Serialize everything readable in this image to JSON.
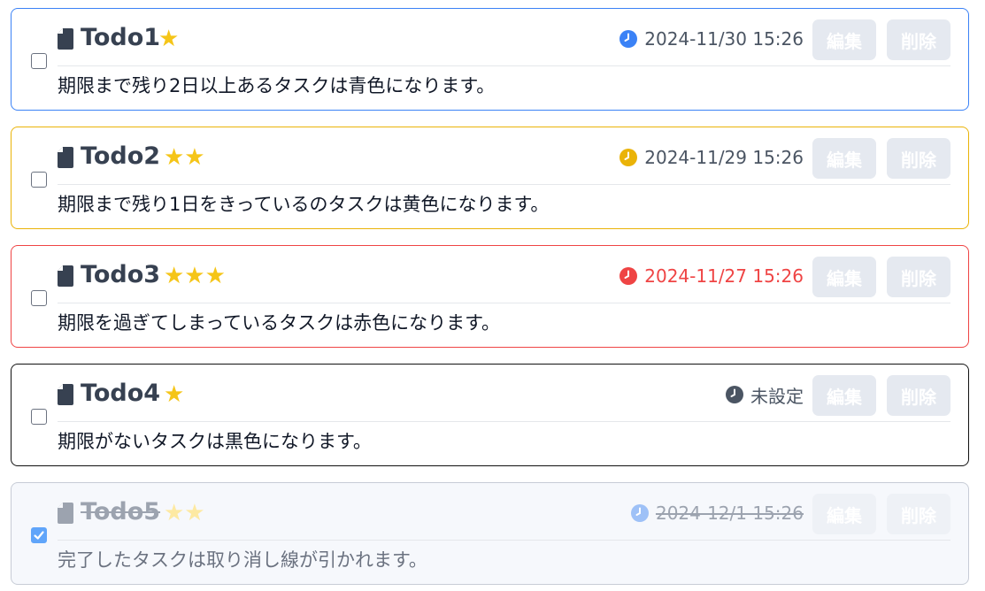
{
  "colors": {
    "blue": "#3b82f6",
    "yellow": "#eab308",
    "red": "#ef4444",
    "black": "#111111",
    "gray": "#c7ccd6",
    "star": "#f5c518"
  },
  "buttons": {
    "edit": "編集",
    "delete": "削除"
  },
  "todos": [
    {
      "title": "Todo1",
      "stars": "★",
      "priority": 1,
      "due": "2024-11/30 15:26",
      "description": "期限まで残り2日以上あるタスクは青色になります。",
      "status_color": "blue",
      "completed": false
    },
    {
      "title": "Todo2",
      "stars": "★★",
      "priority": 2,
      "due": "2024-11/29 15:26",
      "description": "期限まで残り1日をきっているのタスクは黄色になります。",
      "status_color": "yellow",
      "completed": false
    },
    {
      "title": "Todo3",
      "stars": "★★★",
      "priority": 3,
      "due": "2024-11/27 15:26",
      "description": "期限を過ぎてしまっているタスクは赤色になります。",
      "status_color": "red",
      "completed": false
    },
    {
      "title": "Todo4",
      "stars": "★",
      "priority": 1,
      "due": "未設定",
      "description": "期限がないタスクは黒色になります。",
      "status_color": "black",
      "completed": false
    },
    {
      "title": "Todo5",
      "stars": "★★",
      "priority": 2,
      "due": "2024-12/1 15:26",
      "description": "完了したタスクは取り消し線が引かれます。",
      "status_color": "gray",
      "completed": true
    }
  ]
}
